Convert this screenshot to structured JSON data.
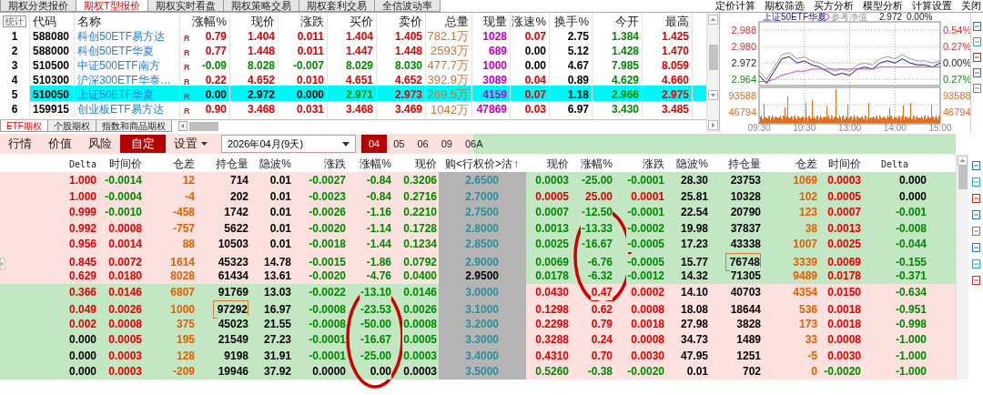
{
  "top_tabs": [
    {
      "label": "期权分类报价",
      "selected": false
    },
    {
      "label": "期权T型报价",
      "selected": true
    },
    {
      "label": "期权实时看盘",
      "selected": false
    },
    {
      "label": "期权策略交易",
      "selected": false
    },
    {
      "label": "期权套利交易",
      "selected": false
    },
    {
      "label": "全信波动率",
      "selected": false
    }
  ],
  "top_menu": [
    "定价计算",
    "期权筛选",
    "买方分析",
    "模型分析",
    "计算设置",
    "关闭"
  ],
  "quote_table": {
    "stat_button": "统计",
    "columns": [
      "代码",
      "名称",
      "涨幅%",
      "现价",
      "涨跌",
      "买价",
      "卖价",
      "总量",
      "现量",
      "涨速%",
      "换手%",
      "今开",
      "最高"
    ],
    "rows": [
      {
        "index": "1",
        "code": "588080",
        "name": "科创50ETF易方达",
        "flag": "R",
        "pct": "0.79",
        "price": "1.404",
        "change": "0.011",
        "bid": "1.404",
        "ask": "1.405",
        "volume": "782.1万",
        "last_volume": "1028",
        "speed": "0.07",
        "turnover": "2.75",
        "open": "1.384",
        "high": "1.425",
        "selected": false
      },
      {
        "index": "2",
        "code": "588000",
        "name": "科创50ETF华夏",
        "flag": "R",
        "pct": "0.77",
        "price": "1.448",
        "change": "0.011",
        "bid": "1.447",
        "ask": "1.448",
        "volume": "2593万",
        "last_volume": "689",
        "speed": "0.00",
        "turnover": "5.12",
        "open": "1.428",
        "high": "1.470",
        "selected": false
      },
      {
        "index": "3",
        "code": "510500",
        "name": "中证500ETF南方",
        "flag": "R",
        "pct": "-0.09",
        "price": "8.028",
        "change": "-0.007",
        "bid": "8.029",
        "ask": "8.030",
        "volume": "477.7万",
        "last_volume": "1000",
        "speed": "0.00",
        "turnover": "4.67",
        "open": "7.985",
        "high": "8.059",
        "selected": false
      },
      {
        "index": "4",
        "code": "510300",
        "name": "沪深300ETF华泰…",
        "flag": "R",
        "pct": "0.22",
        "price": "4.652",
        "change": "0.010",
        "bid": "4.651",
        "ask": "4.652",
        "volume": "392.9万",
        "last_volume": "3089",
        "speed": "0.04",
        "turnover": "0.89",
        "open": "4.629",
        "high": "4.660",
        "selected": false
      },
      {
        "index": "5",
        "code": "510050",
        "name": "上证50ETF华夏",
        "flag": "R",
        "pct": "0.00",
        "price": "2.972",
        "change": "0.000",
        "bid": "2.971",
        "ask": "2.973",
        "volume": "269.5万",
        "last_volume": "4159",
        "speed": "0.07",
        "turnover": "1.18",
        "open": "2.966",
        "high": "2.975",
        "selected": true
      },
      {
        "index": "6",
        "code": "159915",
        "name": "创业板ETF易方达",
        "flag": "R",
        "pct": "0.90",
        "price": "3.468",
        "change": "0.031",
        "bid": "3.468",
        "ask": "3.469",
        "volume": "1042万",
        "last_volume": "47869",
        "speed": "0.03",
        "turnover": "6.97",
        "open": "3.430",
        "high": "3.485",
        "selected": false
      }
    ]
  },
  "market_tabs": [
    {
      "label": "ETF期权",
      "selected": true
    },
    {
      "label": "个股期权",
      "selected": false
    },
    {
      "label": "指数和商品期权",
      "selected": false
    }
  ],
  "chart": {
    "price": "2.972",
    "pct": "0.00%",
    "volume_labels": [
      "93588",
      "46794"
    ],
    "right_labels": [
      "0.54%",
      "0.27%",
      "0.00%",
      "0.27%",
      "93588",
      "46794"
    ],
    "chart_data": {
      "type": "line",
      "categories": [
        "09:30",
        null,
        null,
        null,
        null,
        null,
        "10:30",
        null,
        null,
        null,
        null,
        null,
        "13:00",
        null,
        null,
        null,
        null,
        null,
        "14:00",
        null,
        null,
        null,
        null,
        null,
        "15:00"
      ],
      "yticks": [
        {
          "value": 2.964,
          "label": "2.964"
        },
        {
          "value": 2.972,
          "label": "2.972"
        },
        {
          "value": 2.98,
          "label": "2.980"
        },
        {
          "value": 2.988,
          "label": "2.988"
        }
      ],
      "ylim": [
        2.961,
        2.992
      ],
      "grid": true,
      "series": [
        {
          "name": "上证50ETF华夏",
          "color": "#1a1a7a",
          "values": [
            2.966,
            2.962,
            2.968,
            2.974,
            2.975,
            2.972,
            2.973,
            2.971,
            2.97,
            2.968,
            2.966,
            2.967,
            2.966,
            2.969,
            2.97,
            2.969,
            2.972,
            2.973,
            2.972,
            2.974,
            2.972,
            2.971,
            2.971,
            2.97,
            2.972
          ]
        },
        {
          "color": "#999999",
          "values": [
            2.968,
            2.964,
            2.97,
            2.976,
            2.977,
            2.974,
            2.975,
            2.973,
            2.972,
            2.97,
            2.968,
            2.969,
            2.968,
            2.971,
            2.972,
            2.971,
            2.974,
            2.975,
            2.974,
            2.976,
            2.974,
            2.973,
            2.973,
            2.972,
            2.973
          ]
        },
        {
          "name": "参考净值",
          "color": "#d040d0",
          "values": [
            2.963,
            2.963,
            2.964,
            2.966,
            2.967,
            2.968,
            2.968,
            2.969,
            2.969,
            2.969,
            2.969,
            2.969,
            2.969,
            2.969,
            2.969,
            2.969,
            2.97,
            2.97,
            2.97,
            2.97,
            2.97,
            2.97,
            2.97,
            2.97,
            2.97
          ]
        }
      ]
    }
  },
  "toolbar": {
    "views": [
      {
        "label": "行情",
        "selected": false
      },
      {
        "label": "价值",
        "selected": false
      },
      {
        "label": "风险",
        "selected": false
      },
      {
        "label": "自定",
        "selected": true
      }
    ],
    "settings": "设置",
    "expiry": "2026年04月(9天)",
    "months": [
      {
        "label": "04",
        "selected": true
      },
      {
        "label": "05",
        "selected": false
      },
      {
        "label": "06",
        "selected": false
      },
      {
        "label": "09",
        "selected": false
      },
      {
        "label": "06A",
        "selected": false
      }
    ]
  },
  "option_columns": {
    "call": [
      "Delta",
      "时间价",
      "仓差",
      "持仓量",
      "隐波%",
      "涨跌",
      "涨幅%",
      "现价"
    ],
    "strike": "购<行权价>沽",
    "sort_arrow": "↑",
    "put": [
      "现价",
      "涨幅%",
      "涨跌",
      "隐波%",
      "持仓量",
      "仓差",
      "时间价",
      "Delta"
    ]
  },
  "options": [
    {
      "strike": "2.6500",
      "atm": false,
      "call_itm": true,
      "put_itm": false,
      "call_focused": false,
      "put_focused": false,
      "call": [
        "1.000",
        "-0.0014",
        "12",
        "714",
        "0.01",
        "-0.0027",
        "-0.84",
        "0.3206"
      ],
      "put": [
        "0.0003",
        "-25.00",
        "-0.0001",
        "28.30",
        "23753",
        "1069",
        "0.0003",
        "0.000"
      ]
    },
    {
      "strike": "2.7000",
      "atm": false,
      "call_itm": true,
      "put_itm": false,
      "call_focused": false,
      "put_focused": false,
      "call": [
        "1.000",
        "-0.0004",
        "-4",
        "202",
        "0.01",
        "-0.0023",
        "-0.84",
        "0.2716"
      ],
      "put": [
        "0.0005",
        "25.00",
        "0.0001",
        "25.81",
        "10328",
        "102",
        "0.0005",
        "0.000"
      ]
    },
    {
      "strike": "2.7500",
      "atm": false,
      "call_itm": true,
      "put_itm": false,
      "call_focused": false,
      "put_focused": false,
      "call": [
        "0.999",
        "-0.0010",
        "-458",
        "1742",
        "0.01",
        "-0.0026",
        "-1.16",
        "0.2210"
      ],
      "put": [
        "0.0007",
        "-12.50",
        "-0.0001",
        "22.54",
        "20790",
        "123",
        "0.0007",
        "-0.001"
      ]
    },
    {
      "strike": "2.8000",
      "atm": false,
      "call_itm": true,
      "put_itm": false,
      "call_focused": false,
      "put_focused": false,
      "call": [
        "0.992",
        "0.0008",
        "-757",
        "5622",
        "0.01",
        "-0.0020",
        "-1.14",
        "0.1728"
      ],
      "put": [
        "0.0013",
        "-13.33",
        "-0.0002",
        "19.98",
        "37837",
        "38",
        "0.0013",
        "-0.008"
      ]
    },
    {
      "strike": "2.8500",
      "atm": false,
      "call_itm": true,
      "put_itm": false,
      "call_focused": false,
      "put_focused": false,
      "call": [
        "0.956",
        "0.0014",
        "88",
        "10503",
        "0.01",
        "-0.0018",
        "-1.44",
        "0.1234"
      ],
      "put": [
        "0.0025",
        "-16.67",
        "-0.0005",
        "17.23",
        "43338",
        "1007",
        "0.0025",
        "-0.044"
      ]
    },
    {
      "strike": "2.9000",
      "atm": false,
      "call_itm": true,
      "put_itm": false,
      "call_focused": false,
      "put_focused": true,
      "call": [
        "0.845",
        "0.0072",
        "1614",
        "45323",
        "14.78",
        "-0.0015",
        "-1.86",
        "0.0792"
      ],
      "put": [
        "0.0069",
        "-6.76",
        "-0.0005",
        "15.77",
        "76748",
        "3339",
        "0.0069",
        "-0.155"
      ]
    },
    {
      "strike": "2.9500",
      "atm": true,
      "call_itm": true,
      "put_itm": false,
      "call_focused": false,
      "put_focused": false,
      "call": [
        "0.629",
        "0.0180",
        "8028",
        "61434",
        "13.61",
        "-0.0020",
        "-4.76",
        "0.0400"
      ],
      "put": [
        "0.0178",
        "-6.32",
        "-0.0012",
        "14.32",
        "71305",
        "9489",
        "0.0178",
        "-0.371"
      ]
    },
    {
      "strike": "3.0000",
      "atm": false,
      "call_itm": false,
      "put_itm": true,
      "call_focused": false,
      "put_focused": false,
      "call": [
        "0.366",
        "0.0146",
        "6807",
        "91769",
        "13.03",
        "-0.0022",
        "-13.10",
        "0.0146"
      ],
      "put": [
        "0.0430",
        "0.47",
        "0.0002",
        "14.10",
        "40703",
        "4354",
        "0.0150",
        "-0.634"
      ]
    },
    {
      "strike": "3.1000",
      "atm": false,
      "call_itm": false,
      "put_itm": true,
      "call_focused": true,
      "put_focused": false,
      "call": [
        "0.049",
        "0.0026",
        "1000",
        "97292",
        "16.97",
        "-0.0008",
        "-23.53",
        "0.0026"
      ],
      "put": [
        "0.1298",
        "0.62",
        "0.0008",
        "18.08",
        "18644",
        "536",
        "0.0018",
        "-0.951"
      ]
    },
    {
      "strike": "3.2000",
      "atm": false,
      "call_itm": false,
      "put_itm": true,
      "call_focused": false,
      "put_focused": false,
      "call": [
        "0.002",
        "0.0008",
        "375",
        "45023",
        "21.55",
        "-0.0008",
        "-50.00",
        "0.0008"
      ],
      "put": [
        "0.2298",
        "0.79",
        "0.0018",
        "27.98",
        "3828",
        "173",
        "0.0018",
        "-0.998"
      ]
    },
    {
      "strike": "3.3000",
      "atm": false,
      "call_itm": false,
      "put_itm": true,
      "call_focused": false,
      "put_focused": false,
      "call": [
        "0.000",
        "0.0005",
        "195",
        "21549",
        "27.23",
        "-0.0001",
        "-16.67",
        "0.0005"
      ],
      "put": [
        "0.3288",
        "0.24",
        "0.0008",
        "34.73",
        "1489",
        "33",
        "0.0008",
        "-1.000"
      ]
    },
    {
      "strike": "3.4000",
      "atm": false,
      "call_itm": false,
      "put_itm": true,
      "call_focused": false,
      "put_focused": false,
      "call": [
        "0.000",
        "0.0003",
        "128",
        "9198",
        "31.91",
        "-0.0001",
        "-25.00",
        "0.0003"
      ],
      "put": [
        "0.4310",
        "0.70",
        "0.0030",
        "47.95",
        "1251",
        "-5",
        "0.0030",
        "-1.000"
      ]
    },
    {
      "strike": "3.5000",
      "atm": false,
      "call_itm": false,
      "put_itm": true,
      "call_focused": false,
      "put_focused": false,
      "call": [
        "0.000",
        "0.0003",
        "-209",
        "19946",
        "37.92",
        "0.0000",
        "0.00",
        "0.0003"
      ],
      "put": [
        "0.5260",
        "-0.38",
        "-0.0020",
        "0.01",
        "702",
        "0",
        "-0.0020",
        "-1.000"
      ]
    }
  ],
  "annotations": [
    {
      "kind": "ellipse"
    },
    {
      "kind": "ellipse"
    }
  ]
}
